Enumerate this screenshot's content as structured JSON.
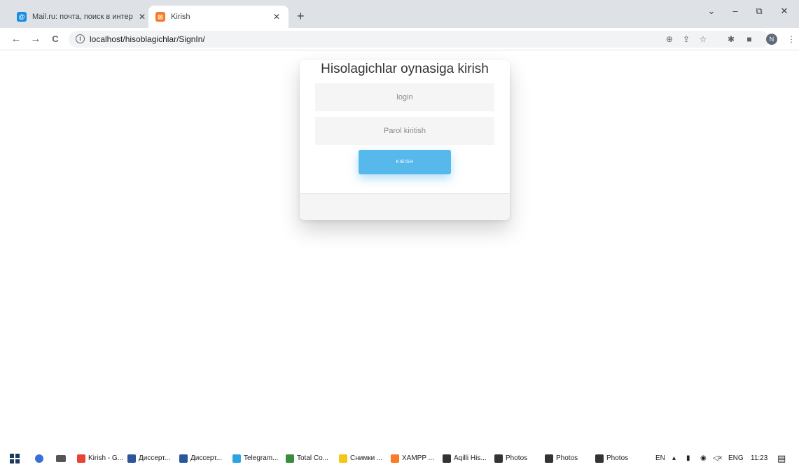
{
  "browser": {
    "tabs": [
      {
        "title": "Mail.ru: почта, поиск в интернет",
        "icon": "mailru-icon",
        "close": "✕",
        "active": false
      },
      {
        "title": "Kirish",
        "icon": "xampp-icon",
        "close": "✕",
        "active": true
      }
    ],
    "new_tab": "+",
    "window_controls": {
      "dropdown": "⌄",
      "minimize": "–",
      "restore": "⧉",
      "close": "✕"
    },
    "nav": {
      "back": "←",
      "forward": "→",
      "reload": "C"
    },
    "url": "localhost/hisoblagichlar/SignIn/",
    "toolbar_icons": {
      "zoom": "⊕",
      "share": "⇪",
      "bookmark": "☆",
      "extensions": "✱",
      "sidepanel": "■",
      "profile_letter": "N",
      "menu": "⋮"
    }
  },
  "login_form": {
    "title": "Hisolagichlar oynasiga kirish",
    "login_placeholder": "login",
    "password_placeholder": "Parol kiritish",
    "submit_label": "KIEISH"
  },
  "taskbar": {
    "items": [
      {
        "label": "Kirish - G...",
        "color": "#e94335"
      },
      {
        "label": "Диссерт...",
        "color": "#2b579a"
      },
      {
        "label": "Диссерт...",
        "color": "#2b579a"
      },
      {
        "label": "Telegram...",
        "color": "#2aa3e0"
      },
      {
        "label": "Total Co...",
        "color": "#3a8d3e"
      },
      {
        "label": "Снимки ...",
        "color": "#f5c518"
      },
      {
        "label": "XAMPP ...",
        "color": "#fb7a24"
      },
      {
        "label": "Aqilli His...",
        "color": "#333333"
      },
      {
        "label": "Photos",
        "color": "#333333"
      },
      {
        "label": "Photos",
        "color": "#333333"
      },
      {
        "label": "Photos",
        "color": "#333333"
      }
    ],
    "tray": {
      "lang_short": "EN",
      "lang": "ENG",
      "time": "11:23"
    }
  }
}
